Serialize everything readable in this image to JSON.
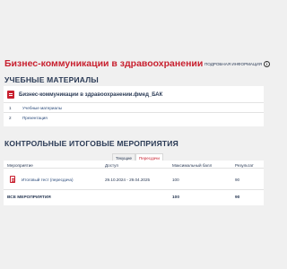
{
  "page": {
    "title": "Бизнес-коммуникации в здравоохранении",
    "info_link": "ПОДРОБНАЯ ИНФОРМАЦИЯ",
    "info_icon": "info-circle-icon"
  },
  "materials": {
    "heading": "УЧЕБНЫЕ МАТЕРИАЛЫ",
    "course_title": "Бизнес-коммуникации в здравоохранении.фмед_БАК",
    "course_icon": "document-icon",
    "items": [
      {
        "num": "1",
        "label": "Учебные материалы"
      },
      {
        "num": "2",
        "label": "Презентация"
      }
    ]
  },
  "events": {
    "heading": "КОНТРОЛЬНЫЕ ИТОГОВЫЕ МЕРОПРИЯТИЯ",
    "tabs": [
      {
        "label": "Текущие",
        "active": false
      },
      {
        "label": "Пересдачи",
        "active": true
      }
    ],
    "columns": {
      "event": "Мероприятие",
      "access": "Доступ",
      "max_score": "Максимальный балл",
      "result": "Результат"
    },
    "rows": [
      {
        "name": "Итоговый тест (пересдача)",
        "icon": "test-list-icon",
        "access": "29.10.2024 - 29.04.2025",
        "max_score": "100",
        "result": "90"
      }
    ],
    "total": {
      "label": "ВСЕ МЕРОПРИЯТИЯ",
      "max_score": "100",
      "result": "90"
    }
  },
  "colors": {
    "accent": "#c8202f",
    "text": "#2a3a55",
    "background": "#f0f0f0"
  }
}
